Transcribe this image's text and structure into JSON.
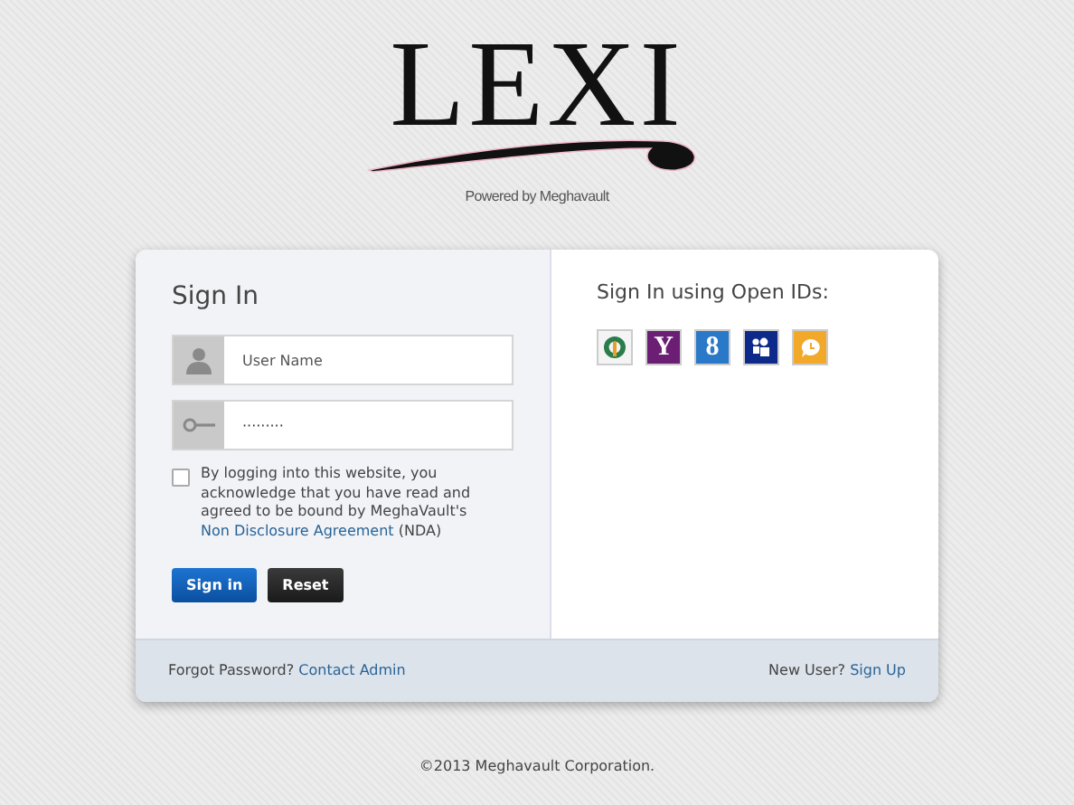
{
  "logo": {
    "title": "LEXI",
    "tagline": "Powered by Meghavault"
  },
  "sign_in": {
    "title": "Sign In",
    "username": {
      "placeholder": "User Name"
    },
    "password": {
      "value": "·········"
    },
    "agreement": {
      "checked": false,
      "text": "By logging into this website, you acknowledge that you have read and agreed to be bound by MeghaVault's",
      "link": "Non Disclosure Agreement",
      "suffix": "(NDA)"
    },
    "buttons": [
      {
        "label": "Sign in",
        "kind": "primary"
      },
      {
        "label": "Reset",
        "kind": "dark"
      }
    ]
  },
  "open_ids": {
    "title": "Sign In using Open IDs:",
    "providers": [
      {
        "kind": "openid"
      },
      {
        "kind": "yahoo",
        "label": "Y"
      },
      {
        "kind": "google",
        "label": "8"
      },
      {
        "kind": "myspace"
      },
      {
        "kind": "blogger"
      }
    ]
  },
  "footer": {
    "forgot": "Forgot Password?",
    "contact_link": "Contact Admin",
    "new_user": "New User?",
    "signup_link": "Sign Up"
  },
  "copyright": "©2013 Meghavault Corporation."
}
